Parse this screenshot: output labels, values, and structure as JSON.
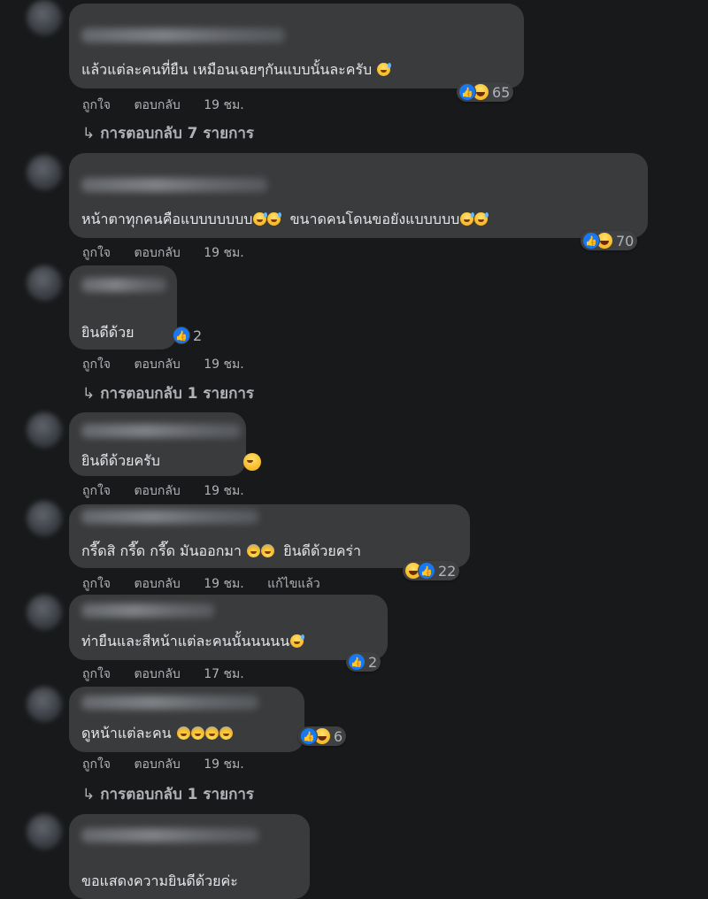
{
  "comments": [
    {
      "text": "แล้วแต่ละคนที่ยืน เหมือนเฉยๆกันแบบนั้นละครับ",
      "reaction_count": "65",
      "like_label": "ถูกใจ",
      "reply_label": "ตอบกลับ",
      "time": "19 ชม.",
      "replies": "การตอบกลับ 7 รายการ"
    },
    {
      "text": "หน้าตาทุกคนคือแบบบบบบบ",
      "text2": "ขนาดคนโดนขอยังแบบบบบ",
      "reaction_count": "70",
      "like_label": "ถูกใจ",
      "reply_label": "ตอบกลับ",
      "time": "19 ชม."
    },
    {
      "text": "ยินดีด้วย",
      "reaction_count": "2",
      "like_label": "ถูกใจ",
      "reply_label": "ตอบกลับ",
      "time": "19 ชม.",
      "replies": "การตอบกลับ 1 รายการ"
    },
    {
      "text": "ยินดีด้วยครับ",
      "like_label": "ถูกใจ",
      "reply_label": "ตอบกลับ",
      "time": "19 ชม."
    },
    {
      "text": "กรี๊ดสิ กรี๊ด กรี๊ด มันออกมา",
      "text2": "ยินดีด้วยคร่า",
      "reaction_count": "22",
      "like_label": "ถูกใจ",
      "reply_label": "ตอบกลับ",
      "time": "19 ชม.",
      "edited": "แก้ไขแล้ว"
    },
    {
      "text": "ท่ายืนและสีหน้าแต่ละคนนั้นนนนน",
      "reaction_count": "2",
      "like_label": "ถูกใจ",
      "reply_label": "ตอบกลับ",
      "time": "17 ชม."
    },
    {
      "text": "ดูหน้าแต่ละคน",
      "reaction_count": "6",
      "like_label": "ถูกใจ",
      "reply_label": "ตอบกลับ",
      "time": "19 ชม.",
      "replies": "การตอบกลับ 1 รายการ"
    },
    {
      "text": "ขอแสดงความยินดีด้วยค่ะ"
    }
  ],
  "icons": {
    "like": "thumbs-up-icon",
    "haha": "laughing-face-icon",
    "reply_arrow": "reply-arrow-icon",
    "emoji": "emoji-icon"
  },
  "colors": {
    "background": "#18191a",
    "bubble": "#3a3b3c",
    "text": "#e4e6eb",
    "secondary": "#b0b3b8",
    "like_blue": "#1877f2"
  }
}
